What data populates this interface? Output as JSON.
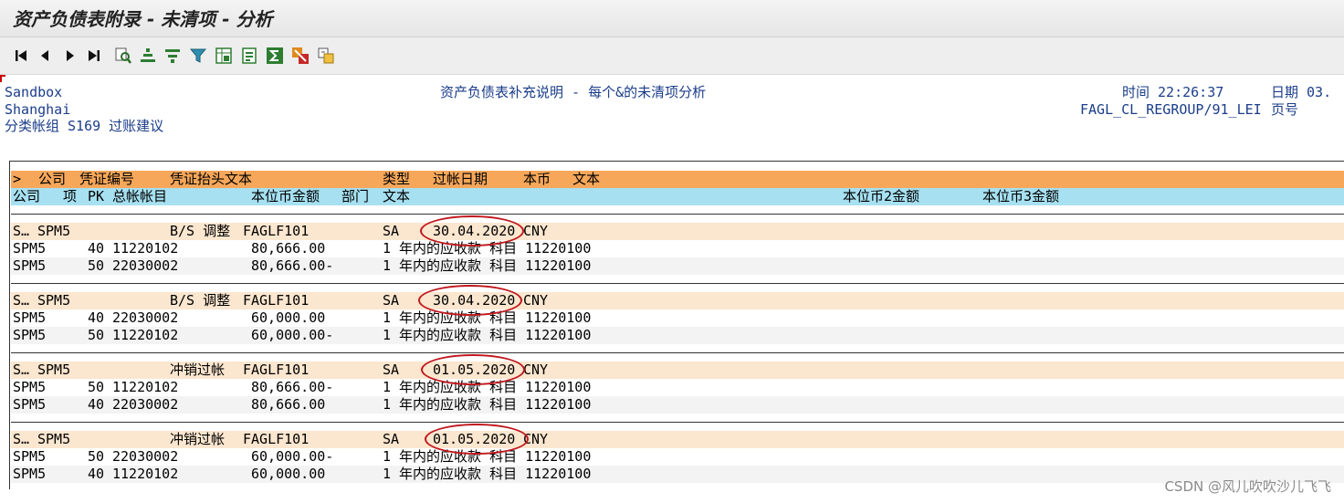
{
  "window": {
    "title": "资产负债表附录 - 未清项 - 分析"
  },
  "toolbar": {
    "buttons": [
      {
        "name": "first-page-icon"
      },
      {
        "name": "previous-page-icon"
      },
      {
        "name": "next-page-icon"
      },
      {
        "name": "last-page-icon"
      },
      {
        "name": "find-icon"
      },
      {
        "name": "sort-ascending-icon"
      },
      {
        "name": "sort-descending-icon"
      },
      {
        "name": "filter-icon"
      },
      {
        "name": "layout-icon"
      },
      {
        "name": "details-icon"
      },
      {
        "name": "sum-icon"
      },
      {
        "name": "subtotal-icon"
      },
      {
        "name": "export-icon"
      }
    ]
  },
  "header": {
    "left_line1": "Sandbox",
    "left_line2": "Shanghai",
    "left_line3": "分类帐组 S169 过账建议",
    "center": "资产负债表补充说明 - 每个&的未清项分析",
    "time_label": "时间 22:26:37",
    "date_label": "日期  03.",
    "program": "FAGL_CL_REGROUP/91_LEI",
    "page_label": "页号"
  },
  "columns_row1": {
    "marker": ">",
    "company": "公司",
    "doc_no": "凭证编号",
    "header_text": "凭证抬头文本",
    "type": "类型",
    "posting_date": "过帐日期",
    "currency": "本币",
    "text": "文本"
  },
  "columns_row2": {
    "company": "公司",
    "item": "项",
    "pk": "PK",
    "gl_account": "总帐帐目",
    "local_amount": "本位币金额",
    "dept": "部门",
    "text": "文本",
    "local_amount2": "本位币2金额",
    "local_amount3": "本位币3金额"
  },
  "documents": [
    {
      "head": {
        "s": "S…",
        "company": "SPM5",
        "header_text": "B/S 调整",
        "ref": "FAGLF101",
        "type": "SA",
        "date": "30.04.2020",
        "currency": "CNY"
      },
      "items": [
        {
          "company": "SPM5",
          "pk": "40",
          "account": "11220102",
          "amount": "80,666.00",
          "text": "1 年内的应收款 科目 11220100"
        },
        {
          "company": "SPM5",
          "pk": "50",
          "account": "22030002",
          "amount": "80,666.00-",
          "text": "1 年内的应收款 科目 11220100"
        }
      ]
    },
    {
      "head": {
        "s": "S…",
        "company": "SPM5",
        "header_text": "B/S 调整",
        "ref": "FAGLF101",
        "type": "SA",
        "date": "30.04.2020",
        "currency": "CNY"
      },
      "items": [
        {
          "company": "SPM5",
          "pk": "40",
          "account": "22030002",
          "amount": "60,000.00",
          "text": "1 年内的应收款 科目 11220100"
        },
        {
          "company": "SPM5",
          "pk": "50",
          "account": "11220102",
          "amount": "60,000.00-",
          "text": "1 年内的应收款 科目 11220100"
        }
      ]
    },
    {
      "head": {
        "s": "S…",
        "company": "SPM5",
        "header_text": "冲销过帐",
        "ref": "FAGLF101",
        "type": "SA",
        "date": "01.05.2020",
        "currency": "CNY"
      },
      "items": [
        {
          "company": "SPM5",
          "pk": "50",
          "account": "11220102",
          "amount": "80,666.00-",
          "text": "1 年内的应收款 科目 11220100"
        },
        {
          "company": "SPM5",
          "pk": "40",
          "account": "22030002",
          "amount": "80,666.00",
          "text": "1 年内的应收款 科目 11220100"
        }
      ]
    },
    {
      "head": {
        "s": "S…",
        "company": "SPM5",
        "header_text": "冲销过帐",
        "ref": "FAGLF101",
        "type": "SA",
        "date": "01.05.2020",
        "currency": "CNY"
      },
      "items": [
        {
          "company": "SPM5",
          "pk": "50",
          "account": "22030002",
          "amount": "60,000.00-",
          "text": "1 年内的应收款 科目 11220100"
        },
        {
          "company": "SPM5",
          "pk": "40",
          "account": "11220102",
          "amount": "60,000.00",
          "text": "1 年内的应收款 科目 11220100"
        }
      ]
    }
  ],
  "watermark": "CSDN @风儿吹吹沙儿飞飞",
  "colors": {
    "header_orange": "#f6a75a",
    "header_blue": "#a6e0f1",
    "doc_row": "#fbe6cf",
    "highlight_circle": "#c0171d",
    "header_text_blue": "#1b3d8a"
  }
}
